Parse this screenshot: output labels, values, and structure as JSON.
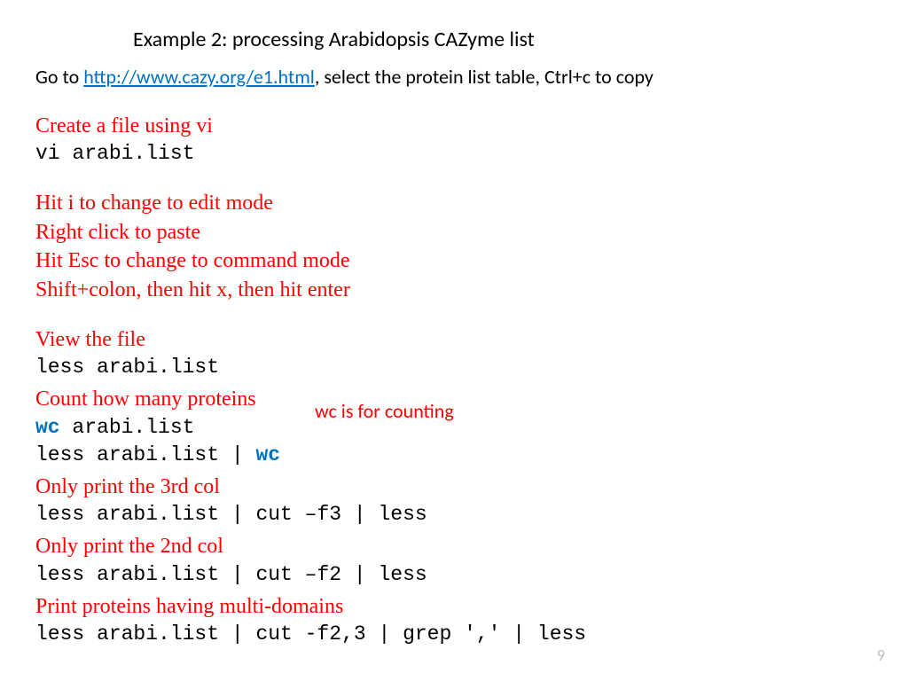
{
  "title": "Example 2: processing Arabidopsis CAZyme list",
  "intro": {
    "prefix": "Go to ",
    "link": "http://www.cazy.org/e1.html",
    "suffix": ", select the protein list table, Ctrl+c to copy"
  },
  "sections": {
    "create_file": "Create a file using vi",
    "vi_cmd": "vi arabi.list",
    "edit1": "Hit i to change to edit mode",
    "edit2": "Right click to paste",
    "edit3": "Hit Esc to change to command mode",
    "edit4": "Shift+colon, then hit x, then hit enter",
    "view_file": "View the file",
    "less_cmd": "less arabi.list",
    "count": "Count how many proteins",
    "wc_bold": "wc",
    "wc_cmd_tail": " arabi.list",
    "pipe_prefix": "less arabi.list | ",
    "pipe_wc": "wc",
    "only3": "Only print the 3rd col",
    "cut3": "less arabi.list | cut –f3 | less",
    "only2": "Only print the 2nd col",
    "cut2": "less arabi.list | cut –f2 | less",
    "multi": "Print proteins having multi-domains",
    "multi_cmd": "less arabi.list | cut -f2,3 | grep ',' | less"
  },
  "note": "wc is for counting",
  "page_number": "9"
}
